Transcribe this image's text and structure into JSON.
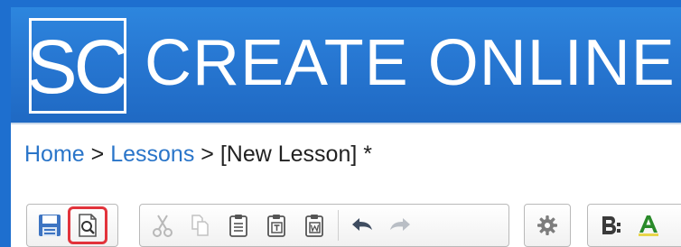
{
  "header": {
    "logo_text": "SC",
    "app_title": "CREATE ONLINE"
  },
  "breadcrumb": {
    "home": "Home",
    "separator": ">",
    "lessons": "Lessons",
    "current": "[New Lesson] *"
  },
  "toolbar": {
    "groups": [
      {
        "buttons": [
          {
            "icon": "save-icon",
            "enabled": true
          },
          {
            "icon": "preview-icon",
            "enabled": true,
            "highlighted": true
          }
        ]
      },
      {
        "buttons": [
          {
            "icon": "cut-icon",
            "enabled": false
          },
          {
            "icon": "copy-icon",
            "enabled": false
          },
          {
            "icon": "paste-icon",
            "enabled": true
          },
          {
            "icon": "paste-text-icon",
            "enabled": true
          },
          {
            "icon": "paste-word-icon",
            "enabled": true
          },
          {
            "icon": "undo-icon",
            "enabled": true
          },
          {
            "icon": "redo-icon",
            "enabled": false
          }
        ]
      },
      {
        "buttons": [
          {
            "icon": "settings-icon",
            "enabled": true
          }
        ]
      },
      {
        "buttons": [
          {
            "icon": "format-icon",
            "enabled": true
          },
          {
            "icon": "text-color-icon",
            "enabled": true
          }
        ]
      }
    ]
  },
  "colors": {
    "header_blue": "#2777d2",
    "link_blue": "#2a75c9",
    "highlight_red": "#e2333b"
  }
}
